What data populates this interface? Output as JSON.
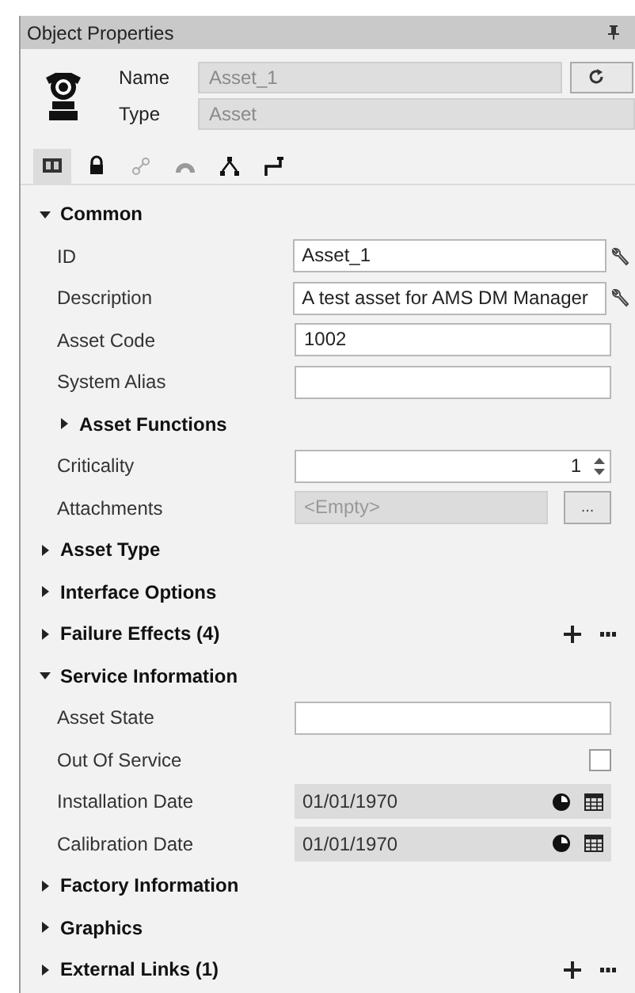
{
  "panel": {
    "title": "Object Properties"
  },
  "header": {
    "name_label": "Name",
    "name_value": "Asset_1",
    "type_label": "Type",
    "type_value": "Asset"
  },
  "toolbar_tabs": [
    {
      "selected": true
    },
    {
      "selected": false
    },
    {
      "selected": false
    },
    {
      "selected": false
    },
    {
      "selected": false
    },
    {
      "selected": false
    }
  ],
  "sections": [
    {
      "label": "Common",
      "expanded": true,
      "actions": false,
      "children": [
        {
          "kind": "text",
          "label": "ID",
          "value": "Asset_1",
          "disabled": false,
          "wrench": true
        },
        {
          "kind": "text",
          "label": "Description",
          "value": "A test asset for AMS DM Manager",
          "disabled": false,
          "wrench": true
        },
        {
          "kind": "text",
          "label": "Asset Code",
          "value": "1002",
          "disabled": false,
          "wrench": false
        },
        {
          "kind": "text",
          "label": "System Alias",
          "disabled": false,
          "wrench": false
        },
        {
          "kind": "subsection",
          "label": "Asset Functions",
          "expanded": false
        },
        {
          "kind": "spinner",
          "label": "Criticality",
          "value": "1"
        },
        {
          "kind": "attachments",
          "label": "Attachments",
          "value": "<Empty>",
          "button": "..."
        }
      ]
    },
    {
      "label": "Asset Type",
      "expanded": false,
      "actions": false
    },
    {
      "label": "Interface Options",
      "expanded": false,
      "actions": false
    },
    {
      "label": "Failure Effects (4)",
      "expanded": false,
      "actions": true
    },
    {
      "label": "Service Information",
      "expanded": true,
      "actions": false,
      "children": [
        {
          "kind": "text",
          "label": "Asset State",
          "disabled": false,
          "wrench": false
        },
        {
          "kind": "checkbox",
          "label": "Out Of Service",
          "checked": false
        },
        {
          "kind": "date",
          "label": "Installation Date",
          "value": "01/01/1970",
          "disabled": true
        },
        {
          "kind": "date",
          "label": "Calibration Date",
          "value": "01/01/1970",
          "disabled": true
        }
      ]
    },
    {
      "label": "Factory Information",
      "expanded": false,
      "actions": false
    },
    {
      "label": "Graphics",
      "expanded": false,
      "actions": false
    },
    {
      "label": "External Links (1)",
      "expanded": false,
      "actions": true
    }
  ]
}
